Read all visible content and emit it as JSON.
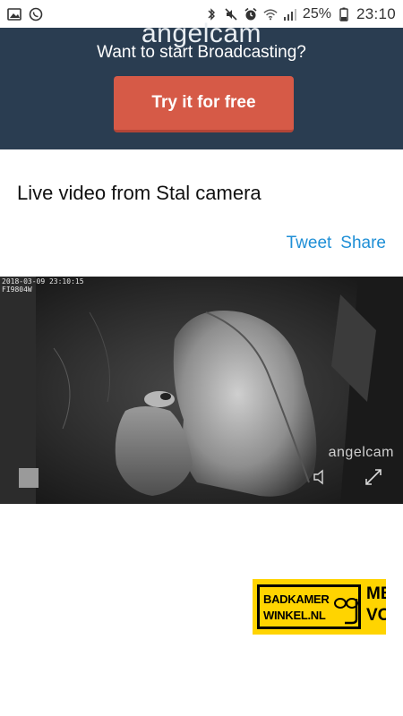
{
  "status_bar": {
    "time": "23:10",
    "battery": "25%",
    "left_icons": [
      "image-icon",
      "whatsapp-icon"
    ],
    "right_icons": [
      "bluetooth-icon",
      "mute-icon",
      "alarm-icon",
      "wifi-icon",
      "signal-icon",
      "battery-icon"
    ]
  },
  "banner": {
    "brand": "angelcam",
    "text": "Want to start Broadcasting?",
    "cta_label": "Try it for free",
    "background": "#2a3d51",
    "cta_color": "#d65a47"
  },
  "page": {
    "title": "Live video from Stal camera"
  },
  "share": {
    "tweet_label": "Tweet",
    "share_label": "Share",
    "link_color": "#1f8fd6"
  },
  "video": {
    "timestamp": "2018-03-09  23:10:15",
    "camera_id": "FI9804W",
    "watermark": "angelcam",
    "controls": [
      "stop-icon",
      "volume-icon",
      "fullscreen-icon"
    ]
  },
  "ad": {
    "brand_line1": "BADKAMER",
    "brand_line2": "WINKEL.NL",
    "cut_text1": "ME",
    "cut_text2": "VO",
    "background": "#ffd400"
  }
}
